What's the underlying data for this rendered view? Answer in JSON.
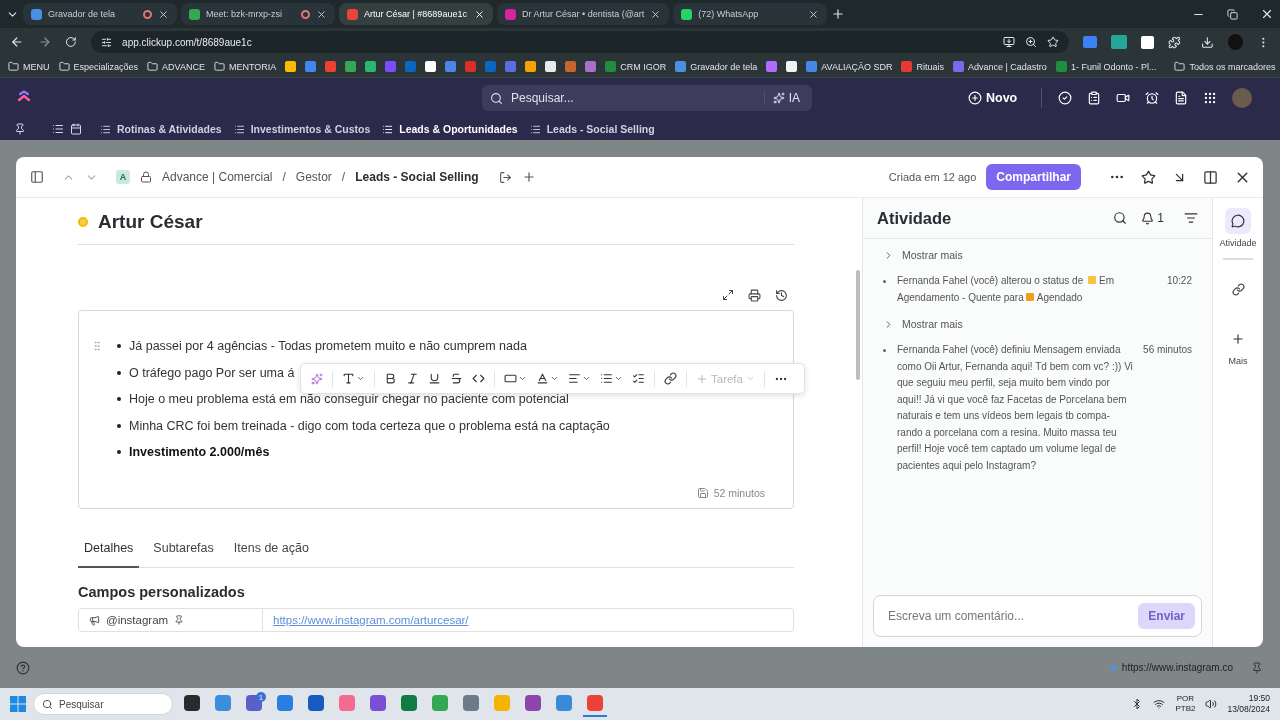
{
  "browser": {
    "tabs": [
      {
        "title": "Gravador de tela",
        "selected": false,
        "recording": true,
        "color": "#4a90e2"
      },
      {
        "title": "Meet: bzk-mrxp-zsi",
        "selected": false,
        "recording": true,
        "color": "#34a853"
      },
      {
        "title": "Artur César | #8689aue1c",
        "selected": true,
        "recording": false,
        "color": "#e8453c"
      },
      {
        "title": "Dr Artur César • dentista (@art",
        "selected": false,
        "recording": false,
        "color": "#d6249f"
      },
      {
        "title": "(72) WhatsApp",
        "selected": false,
        "recording": false,
        "color": "#25d366"
      }
    ],
    "url": "app.clickup.com/t/8689aue1c",
    "bookmarks": [
      {
        "kind": "folder",
        "label": "MENU"
      },
      {
        "kind": "folder",
        "label": "Especializações"
      },
      {
        "kind": "folder",
        "label": "ADVANCE"
      },
      {
        "kind": "folder",
        "label": "MENTORIA"
      },
      {
        "kind": "icon",
        "color": "#fbbc04"
      },
      {
        "kind": "icon",
        "color": "#4285f4"
      },
      {
        "kind": "icon",
        "color": "#ea4335"
      },
      {
        "kind": "icon",
        "color": "#34a853"
      },
      {
        "kind": "icon",
        "color": "#2bb673"
      },
      {
        "kind": "icon",
        "color": "#7b4dff"
      },
      {
        "kind": "icon",
        "color": "#0a66c2"
      },
      {
        "kind": "icon",
        "color": "#ffffff"
      },
      {
        "kind": "icon",
        "color": "#4a86e8"
      },
      {
        "kind": "icon",
        "color": "#d93025"
      },
      {
        "kind": "icon",
        "color": "#0a66c2"
      },
      {
        "kind": "icon",
        "color": "#5b6ee1"
      },
      {
        "kind": "icon",
        "color": "#f4a300"
      },
      {
        "kind": "icon",
        "color": "#e8eaed"
      },
      {
        "kind": "icon",
        "color": "#c8642d"
      },
      {
        "kind": "icon",
        "color": "#a96ec9"
      },
      {
        "kind": "site",
        "label": "CRM IGOR",
        "color": "#1e8e3e"
      },
      {
        "kind": "site",
        "label": "Gravador de tela",
        "color": "#4a90e2"
      },
      {
        "kind": "icon",
        "color": "#b36bff"
      },
      {
        "kind": "icon",
        "color": "#f1f3f4"
      },
      {
        "kind": "site",
        "label": "AVALIAÇÃO SDR",
        "color": "#4a86e8"
      },
      {
        "kind": "site",
        "label": "Rituais",
        "color": "#e53935"
      },
      {
        "kind": "site",
        "label": "Advance | Cadastro",
        "color": "#7b68ee"
      },
      {
        "kind": "site",
        "label": "1- Funil Odonto - Pl...",
        "color": "#1e8e3e"
      }
    ],
    "all_bookmarks": "Todos os marcadores"
  },
  "clickup": {
    "search_placeholder": "Pesquisar...",
    "ai_label": "IA",
    "new_label": "Novo",
    "nav": [
      {
        "label": "Rotinas & Atividades",
        "selected": false
      },
      {
        "label": "Investimentos & Custos",
        "selected": false
      },
      {
        "label": "Leads & Oportunidades",
        "selected": true
      },
      {
        "label": "Leads - Social Selling",
        "selected": false
      }
    ]
  },
  "task": {
    "space_badge": "A",
    "separator": "/",
    "breadcrumb": [
      "Advance | Comercial",
      "Gestor",
      "Leads - Social Selling"
    ],
    "created": "Criada em 12 ago",
    "share": "Compartilhar",
    "title": "Artur César",
    "bullets": [
      {
        "text": "Já passei por 4 agências - Todas prometem muito e não cumprem nada",
        "bold": false
      },
      {
        "text": "O tráfego pago Por ser uma á",
        "bold": false
      },
      {
        "text": "Hoje o meu problema está em não conseguir chegar no paciente com potencial",
        "bold": false
      },
      {
        "text": "Minha CRC foi bem treinada - digo com toda certeza que o problema está na captação",
        "bold": false
      },
      {
        "text": "Investimento 2.000/mês",
        "bold": true
      }
    ],
    "task_button": {
      "label": "Tarefa",
      "disabled": true
    },
    "saved": "52 minutos",
    "tabs": [
      {
        "label": "Detalhes",
        "selected": true
      },
      {
        "label": "Subtarefas",
        "selected": false
      },
      {
        "label": "Itens de ação",
        "selected": false
      }
    ],
    "custom_fields_title": "Campos personalizados",
    "fields": [
      {
        "name": "@instagram",
        "value": "https://www.instagram.com/arturcesar/"
      }
    ]
  },
  "activity": {
    "title": "Atividade",
    "notifications": "1",
    "entries": [
      {
        "kind": "show_more",
        "label": "Mostrar mais"
      },
      {
        "kind": "status",
        "text": "Fernanda Fahel (você) alterou o status de",
        "from": {
          "label": "Em Agendamento - Quente",
          "color": "#f5c542"
        },
        "connector": "para",
        "to": {
          "label": "Agendado",
          "color": "#f29d1c"
        },
        "time": "10:22"
      },
      {
        "kind": "show_more",
        "label": "Mostrar mais"
      },
      {
        "kind": "message",
        "text": "Fernanda Fahel (você) definiu Mensagem enviada como  Oii Artur, Fernanda aqui! Td bem com vc? :)) Vi que seguiu meu perfil, seja muito bem vindo por aqui!! Já vi que você faz Facetas de Porcelana bem naturais e tem uns vídeos bem legais tb compa-rando a porcelana com a resina. Muito massa teu perfil! Hoje você tem captado um volume legal de pacientes aqui pelo Instagram?",
        "time": "56 minutos"
      }
    ],
    "comment_placeholder": "Escreva um comentário...",
    "send": {
      "label": "Enviar",
      "disabled": true
    }
  },
  "rail": [
    {
      "kind": "activity",
      "label": "Atividade",
      "selected": true
    },
    {
      "kind": "links",
      "selected": false
    },
    {
      "kind": "more",
      "label": "Mais",
      "selected": false
    }
  ],
  "status_url": "https://www.instagram.co",
  "taskbar": {
    "search_placeholder": "Pesquisar",
    "apps": [
      {
        "color": "#2b2b2b",
        "selected": false
      },
      {
        "color": "#3c8dde",
        "selected": false
      },
      {
        "color": "#5b5fc7",
        "selected": false,
        "badge": "1"
      },
      {
        "color": "#2a7de1",
        "selected": false
      },
      {
        "color": "#185abd",
        "selected": false
      },
      {
        "color": "#f36b8f",
        "selected": false
      },
      {
        "color": "#7a4fd6",
        "selected": false
      },
      {
        "color": "#107c41",
        "selected": false
      },
      {
        "color": "#34a853",
        "selected": false
      },
      {
        "color": "#6c7a89",
        "selected": false
      },
      {
        "color": "#f4b400",
        "selected": false
      },
      {
        "color": "#8e44ad",
        "selected": false
      },
      {
        "color": "#3b8ad9",
        "selected": false
      },
      {
        "color": "#ea4335",
        "selected": true
      }
    ],
    "language": "POR",
    "layout": "PTB2",
    "time": "19:50",
    "date": "13/08/2024"
  }
}
